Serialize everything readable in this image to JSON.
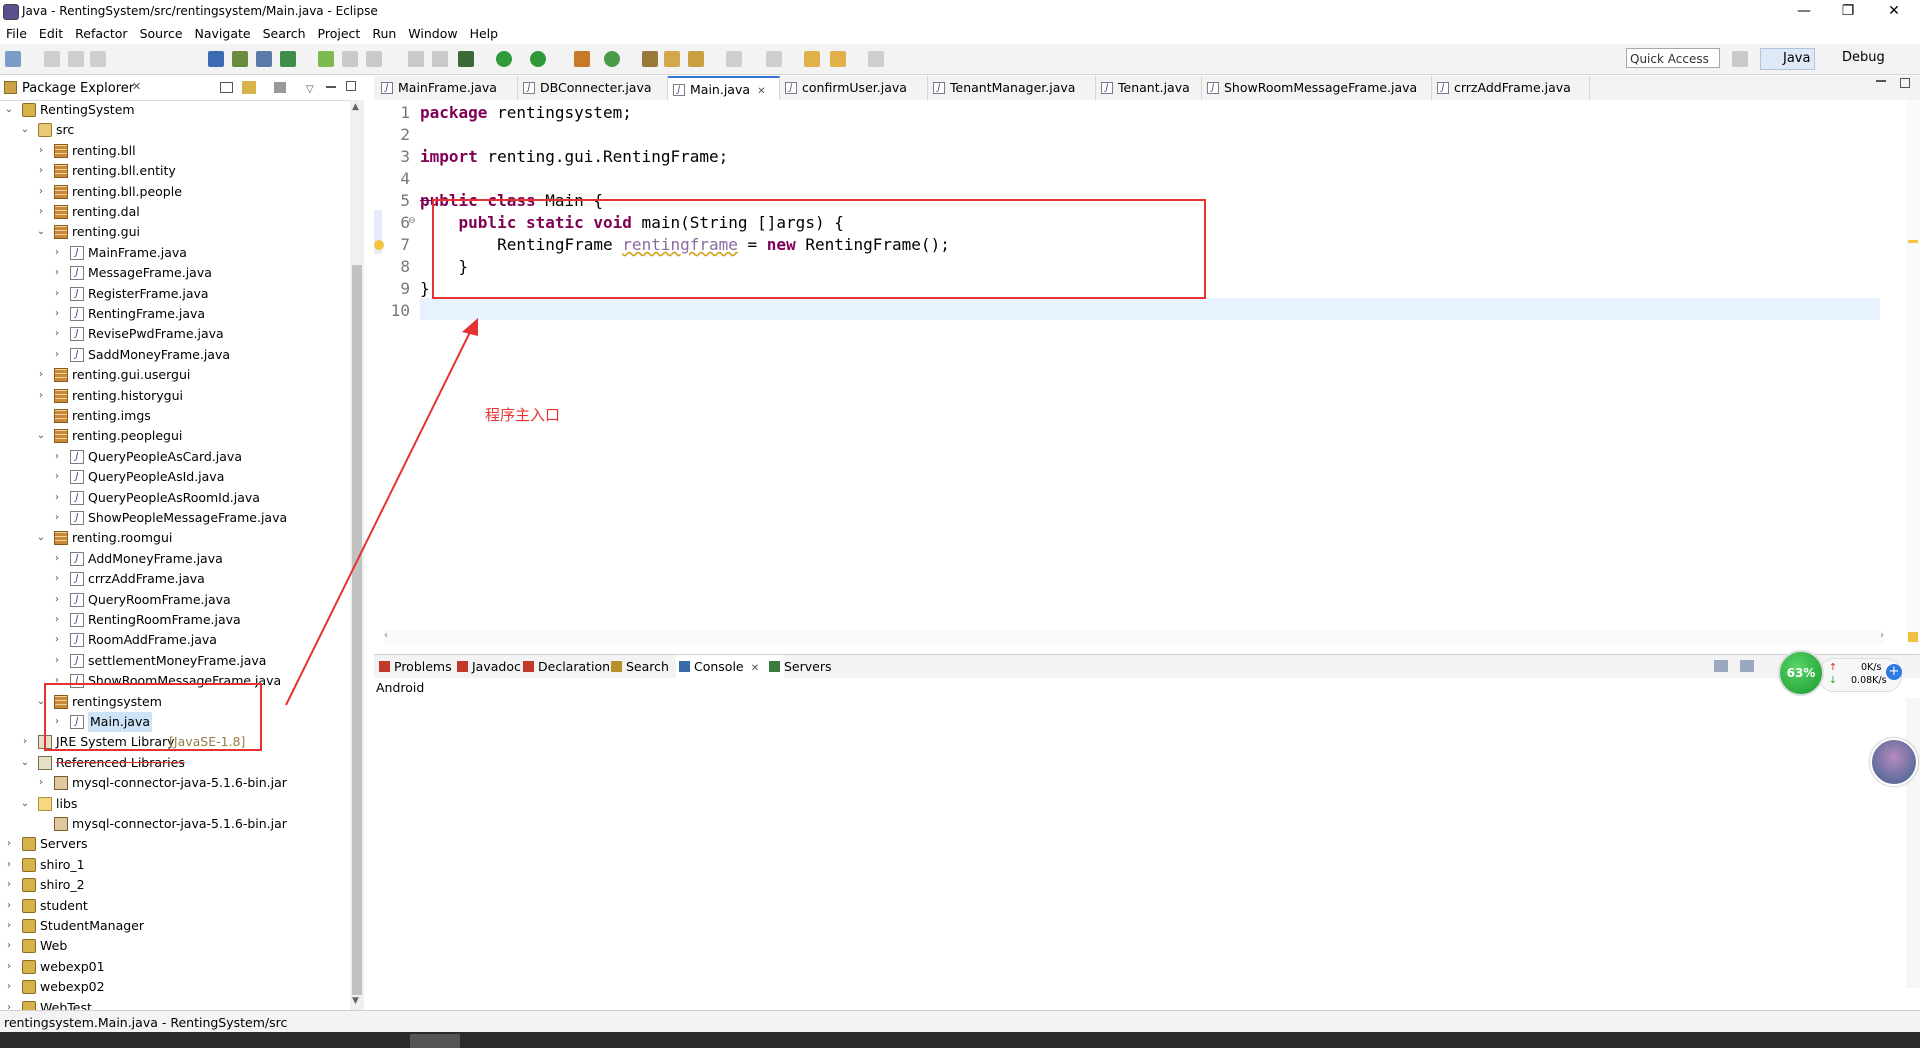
{
  "window": {
    "title": "Java - RentingSystem/src/rentingsystem/Main.java - Eclipse",
    "minimize": "—",
    "maximize": "❐",
    "close": "✕"
  },
  "menu": [
    "File",
    "Edit",
    "Refactor",
    "Source",
    "Navigate",
    "Search",
    "Project",
    "Run",
    "Window",
    "Help"
  ],
  "toolbar": {
    "quick_access": "Quick Access",
    "perspective_java": "Java",
    "perspective_debug": "Debug"
  },
  "package_explorer": {
    "title": "Package Explorer",
    "close": "✕",
    "tree": [
      {
        "label": "RentingSystem",
        "indent": 0,
        "arrow": "open",
        "icon": "project"
      },
      {
        "label": "src",
        "indent": 1,
        "arrow": "open",
        "icon": "src-folder"
      },
      {
        "label": "renting.bll",
        "indent": 2,
        "arrow": "closed",
        "icon": "package"
      },
      {
        "label": "renting.bll.entity",
        "indent": 2,
        "arrow": "closed",
        "icon": "package"
      },
      {
        "label": "renting.bll.people",
        "indent": 2,
        "arrow": "closed",
        "icon": "package"
      },
      {
        "label": "renting.dal",
        "indent": 2,
        "arrow": "closed",
        "icon": "package"
      },
      {
        "label": "renting.gui",
        "indent": 2,
        "arrow": "open",
        "icon": "package"
      },
      {
        "label": "MainFrame.java",
        "indent": 3,
        "arrow": "closed",
        "icon": "java-file"
      },
      {
        "label": "MessageFrame.java",
        "indent": 3,
        "arrow": "closed",
        "icon": "java-file"
      },
      {
        "label": "RegisterFrame.java",
        "indent": 3,
        "arrow": "closed",
        "icon": "java-file"
      },
      {
        "label": "RentingFrame.java",
        "indent": 3,
        "arrow": "closed",
        "icon": "java-file"
      },
      {
        "label": "RevisePwdFrame.java",
        "indent": 3,
        "arrow": "closed",
        "icon": "java-file"
      },
      {
        "label": "SaddMoneyFrame.java",
        "indent": 3,
        "arrow": "closed",
        "icon": "java-file"
      },
      {
        "label": "renting.gui.usergui",
        "indent": 2,
        "arrow": "closed",
        "icon": "package"
      },
      {
        "label": "renting.historygui",
        "indent": 2,
        "arrow": "closed",
        "icon": "package"
      },
      {
        "label": "renting.imgs",
        "indent": 2,
        "arrow": "none",
        "icon": "package"
      },
      {
        "label": "renting.peoplegui",
        "indent": 2,
        "arrow": "open",
        "icon": "package"
      },
      {
        "label": "QueryPeopleAsCard.java",
        "indent": 3,
        "arrow": "closed",
        "icon": "java-file"
      },
      {
        "label": "QueryPeopleAsId.java",
        "indent": 3,
        "arrow": "closed",
        "icon": "java-file"
      },
      {
        "label": "QueryPeopleAsRoomId.java",
        "indent": 3,
        "arrow": "closed",
        "icon": "java-file"
      },
      {
        "label": "ShowPeopleMessageFrame.java",
        "indent": 3,
        "arrow": "closed",
        "icon": "java-file"
      },
      {
        "label": "renting.roomgui",
        "indent": 2,
        "arrow": "open",
        "icon": "package"
      },
      {
        "label": "AddMoneyFrame.java",
        "indent": 3,
        "arrow": "closed",
        "icon": "java-file"
      },
      {
        "label": "crrzAddFrame.java",
        "indent": 3,
        "arrow": "closed",
        "icon": "java-file"
      },
      {
        "label": "QueryRoomFrame.java",
        "indent": 3,
        "arrow": "closed",
        "icon": "java-file"
      },
      {
        "label": "RentingRoomFrame.java",
        "indent": 3,
        "arrow": "closed",
        "icon": "java-file"
      },
      {
        "label": "RoomAddFrame.java",
        "indent": 3,
        "arrow": "closed",
        "icon": "java-file"
      },
      {
        "label": "settlementMoneyFrame.java",
        "indent": 3,
        "arrow": "closed",
        "icon": "java-file"
      },
      {
        "label": "ShowRoomMessageFrame.java",
        "indent": 3,
        "arrow": "closed",
        "icon": "java-file"
      },
      {
        "label": "rentingsystem",
        "indent": 2,
        "arrow": "open",
        "icon": "package"
      },
      {
        "label": "Main.java",
        "indent": 3,
        "arrow": "closed",
        "icon": "java-file",
        "selected": true
      },
      {
        "label": "JRE System Library",
        "suffix": "[JavaSE-1.8]",
        "indent": 1,
        "arrow": "closed",
        "icon": "library"
      },
      {
        "label": "Referenced Libraries",
        "indent": 1,
        "arrow": "open",
        "icon": "library",
        "struck": true
      },
      {
        "label": "mysql-connector-java-5.1.6-bin.jar",
        "indent": 2,
        "arrow": "closed",
        "icon": "jar"
      },
      {
        "label": "libs",
        "indent": 1,
        "arrow": "open",
        "icon": "folder"
      },
      {
        "label": "mysql-connector-java-5.1.6-bin.jar",
        "indent": 2,
        "arrow": "none",
        "icon": "jar"
      },
      {
        "label": "Servers",
        "indent": 0,
        "arrow": "closed",
        "icon": "project"
      },
      {
        "label": "shiro_1",
        "indent": 0,
        "arrow": "closed",
        "icon": "project"
      },
      {
        "label": "shiro_2",
        "indent": 0,
        "arrow": "closed",
        "icon": "project"
      },
      {
        "label": "student",
        "indent": 0,
        "arrow": "closed",
        "icon": "project"
      },
      {
        "label": "StudentManager",
        "indent": 0,
        "arrow": "closed",
        "icon": "project"
      },
      {
        "label": "Web",
        "indent": 0,
        "arrow": "closed",
        "icon": "project"
      },
      {
        "label": "webexp01",
        "indent": 0,
        "arrow": "closed",
        "icon": "project"
      },
      {
        "label": "webexp02",
        "indent": 0,
        "arrow": "closed",
        "icon": "project"
      },
      {
        "label": "WebTest",
        "indent": 0,
        "arrow": "closed",
        "icon": "project"
      }
    ]
  },
  "editor": {
    "tabs": [
      "MainFrame.java",
      "DBConnecter.java",
      "Main.java",
      "confirmUser.java",
      "TenantManager.java",
      "Tenant.java",
      "ShowRoomMessageFrame.java",
      "crrzAddFrame.java"
    ],
    "active_tab": "Main.java",
    "tab_close": "✕",
    "lines": [
      [
        {
          "t": "package",
          "k": 1
        },
        {
          "t": " rentingsystem;"
        }
      ],
      [],
      [
        {
          "t": "import",
          "k": 1
        },
        {
          "t": " renting.gui.RentingFrame;"
        }
      ],
      [],
      [
        {
          "t": "public class",
          "k": 1,
          "s": 1
        },
        {
          "t": " Main {",
          "s": 1
        }
      ],
      [
        {
          "t": "    "
        },
        {
          "t": "public static void",
          "k": 1
        },
        {
          "t": " main(String []args) {"
        }
      ],
      [
        {
          "t": "        RentingFrame "
        },
        {
          "t": "rentingframe",
          "w": 1
        },
        {
          "t": " = "
        },
        {
          "t": "new",
          "k": 1
        },
        {
          "t": " RentingFrame();"
        }
      ],
      [
        {
          "t": "    }"
        }
      ],
      [
        {
          "t": "}"
        }
      ],
      []
    ],
    "annotation": "程序主入口"
  },
  "bottom_panel": {
    "tabs": [
      "Problems",
      "Javadoc",
      "Declaration",
      "Search",
      "Console",
      "Servers"
    ],
    "active_tab": "Console",
    "tab_close": "✕",
    "console_label": "Android"
  },
  "net_widget": {
    "percent": "63%",
    "up": "0K/s",
    "down": "0.08K/s"
  },
  "status_bar": "rentingsystem.Main.java - RentingSystem/src"
}
